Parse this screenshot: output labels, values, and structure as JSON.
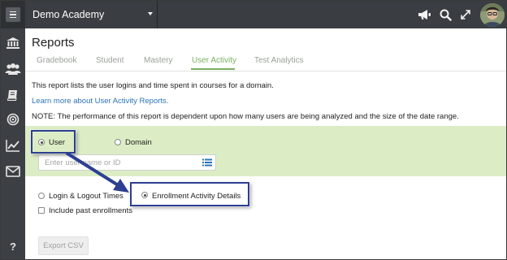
{
  "topbar": {
    "org_name": "Demo Academy"
  },
  "sidebar": {
    "items": [
      {
        "icon": "menu-icon"
      },
      {
        "icon": "institution-icon"
      },
      {
        "icon": "users-icon"
      },
      {
        "icon": "book-icon"
      },
      {
        "icon": "target-icon"
      },
      {
        "icon": "chart-line-icon"
      },
      {
        "icon": "mail-icon"
      },
      {
        "icon": "help-icon",
        "label": "?"
      }
    ]
  },
  "page": {
    "title": "Reports",
    "tabs": [
      {
        "label": "Gradebook",
        "active": false
      },
      {
        "label": "Student",
        "active": false
      },
      {
        "label": "Mastery",
        "active": false
      },
      {
        "label": "User Activity",
        "active": true
      },
      {
        "label": "Test Analytics",
        "active": false
      }
    ]
  },
  "content": {
    "description": "This report lists the user logins and time spent in courses for a domain.",
    "learn_more": "Learn more about User Activity Reports.",
    "note": "NOTE: The performance of this report is dependent upon how many users are being analyzed and the size of the date range."
  },
  "scope": {
    "options": [
      {
        "label": "User",
        "selected": true
      },
      {
        "label": "Domain",
        "selected": false
      }
    ],
    "user_field": {
      "placeholder": "Enter user name or ID",
      "value": ""
    }
  },
  "report_type": {
    "options": [
      {
        "label": "Login & Logout Times",
        "selected": false
      },
      {
        "label": "Enrollment Activity Details",
        "selected": true
      }
    ],
    "include_past_label": "Include past enrollments",
    "include_past_checked": false
  },
  "actions": {
    "export_label": "Export CSV"
  },
  "colors": {
    "accent_green": "#7ab060",
    "panel_green": "#dcedc6",
    "link_blue": "#2a74b8",
    "highlight_blue": "#2c3f91"
  }
}
